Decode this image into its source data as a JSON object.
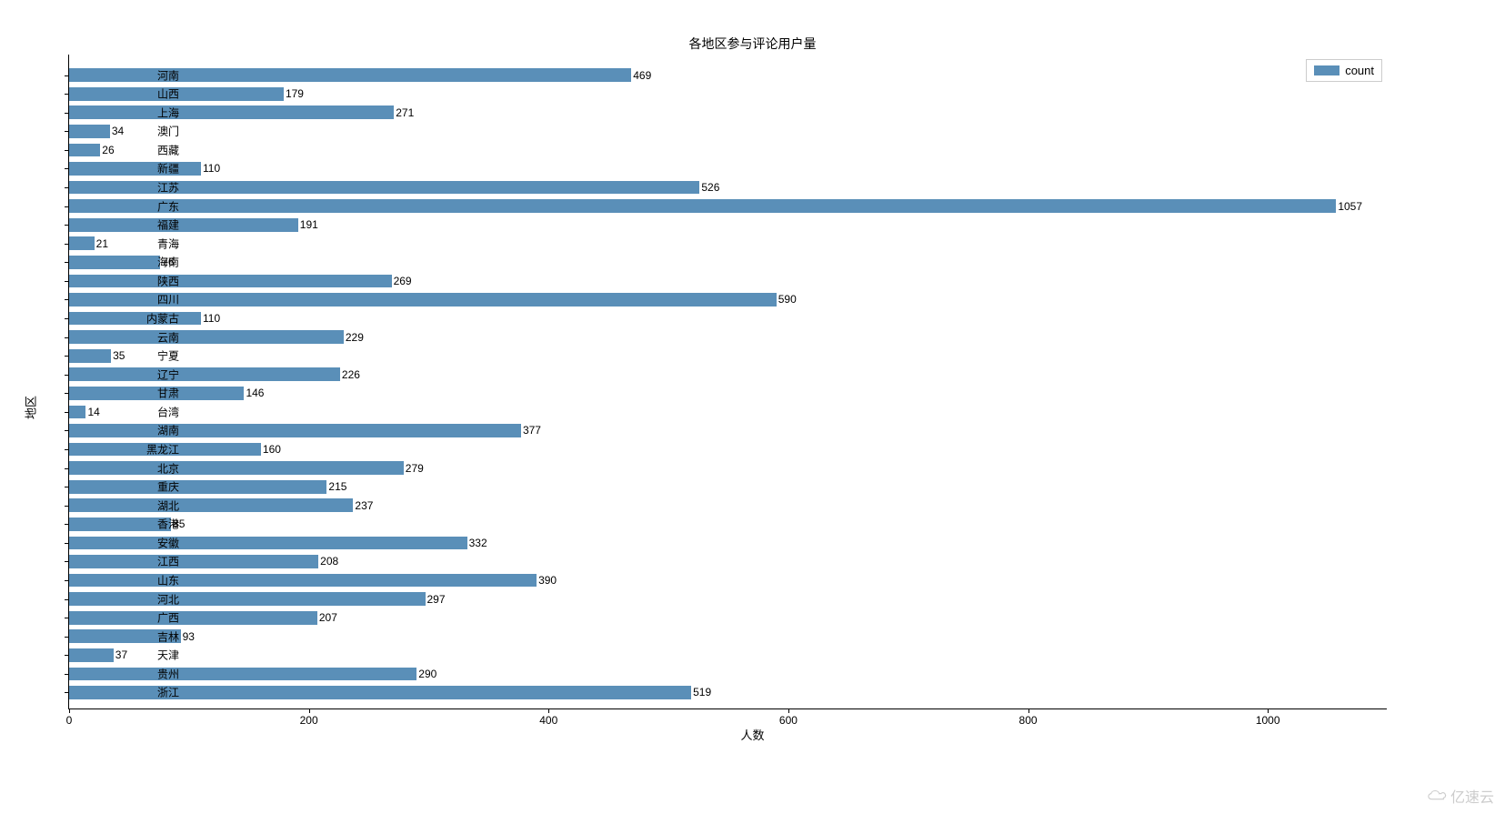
{
  "chart_data": {
    "type": "bar",
    "orientation": "horizontal",
    "title": "各地区参与评论用户量",
    "xlabel": "人数",
    "ylabel": "地区",
    "legend": "count",
    "xlim": [
      0,
      1100
    ],
    "xticks": [
      0,
      200,
      400,
      600,
      800,
      1000
    ],
    "categories": [
      "河南",
      "山西",
      "上海",
      "澳门",
      "西藏",
      "新疆",
      "江苏",
      "广东",
      "福建",
      "青海",
      "海南",
      "陕西",
      "四川",
      "内蒙古",
      "云南",
      "宁夏",
      "辽宁",
      "甘肃",
      "台湾",
      "湖南",
      "黑龙江",
      "北京",
      "重庆",
      "湖北",
      "香港",
      "安徽",
      "江西",
      "山东",
      "河北",
      "广西",
      "吉林",
      "天津",
      "贵州",
      "浙江"
    ],
    "values": [
      469,
      179,
      271,
      34,
      26,
      110,
      526,
      1057,
      191,
      21,
      76,
      269,
      590,
      110,
      229,
      35,
      226,
      146,
      14,
      377,
      160,
      279,
      215,
      237,
      85,
      332,
      208,
      390,
      297,
      207,
      93,
      37,
      290,
      519
    ],
    "bar_color": "#5a8fb8"
  },
  "watermark": "亿速云"
}
